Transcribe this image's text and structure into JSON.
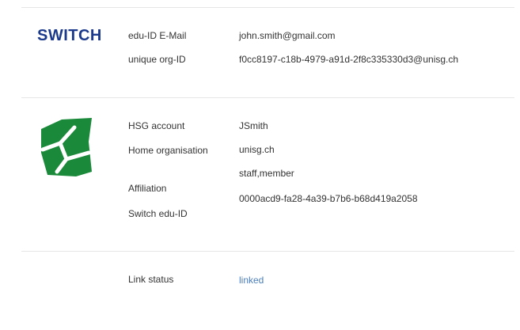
{
  "colors": {
    "switch_brand": "#1b3a8c",
    "hsg_green": "#1a8a3a",
    "link": "#4a7ebb",
    "divider": "#e6e6e6"
  },
  "switch_section": {
    "logo_text": "SWITCH",
    "rows": [
      {
        "label": "edu-ID E-Mail",
        "value": "john.smith@gmail.com"
      },
      {
        "label": "unique org-ID",
        "value": "f0cc8197-c18b-4979-a91d-2f8c335330d3@unisg.ch"
      }
    ]
  },
  "hsg_section": {
    "logo_icon": "hsg-logo-icon",
    "labels": [
      "HSG account",
      "Home organisation",
      "Affiliation",
      "Switch edu-ID"
    ],
    "values": [
      "JSmith",
      "unisg.ch",
      "staff,member",
      "0000acd9-fa28-4a39-b7b6-b68d419a2058"
    ]
  },
  "link_section": {
    "label": "Link status",
    "value": "linked"
  }
}
